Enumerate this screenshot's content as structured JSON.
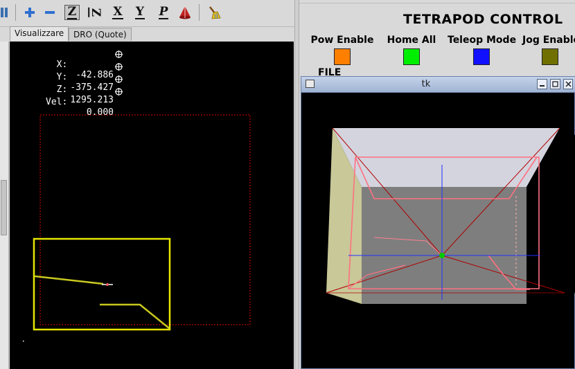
{
  "toolbar": {
    "buttons": [
      {
        "name": "zoom-in",
        "icon": "plus-icon"
      },
      {
        "name": "zoom-out",
        "icon": "minus-icon"
      },
      {
        "name": "view-z",
        "letter": "Z",
        "active": true
      },
      {
        "name": "view-z-rotated",
        "letter": "Z"
      },
      {
        "name": "view-x",
        "letter": "X"
      },
      {
        "name": "view-y",
        "letter": "Y"
      },
      {
        "name": "view-p",
        "letter": "P"
      },
      {
        "name": "toggle-tool",
        "icon": "cone-icon"
      },
      {
        "name": "clear-plot",
        "icon": "broom-icon"
      }
    ]
  },
  "tabs": [
    "Visualizzare",
    "DRO (Quote)"
  ],
  "dro": [
    {
      "label": "X:",
      "value": "-42.886"
    },
    {
      "label": "Y:",
      "value": "-375.427"
    },
    {
      "label": "Z:",
      "value": "1295.213"
    },
    {
      "label": "Vel:",
      "value": "0.000"
    }
  ],
  "tetrapod": {
    "title": "TETRAPOD CONTROL",
    "controls": [
      {
        "label": "Pow Enable",
        "color": "#ff8000"
      },
      {
        "label": "Home All",
        "color": "#00ee00"
      },
      {
        "label": "Teleop Mode",
        "color": "#1010ff"
      },
      {
        "label": "Jog Enable",
        "color": "#707000"
      }
    ],
    "file_label": "FILE"
  },
  "tk_window": {
    "title": "tk",
    "buttons": [
      "minimize",
      "maximize",
      "close"
    ]
  },
  "colors": {
    "plot_bg": "#000000",
    "limit_box": "#e00000",
    "tool_path": "#e6e600",
    "highlight": "#ff7080",
    "axis_blue": "#2030ff",
    "axis_green": "#00cc00"
  }
}
